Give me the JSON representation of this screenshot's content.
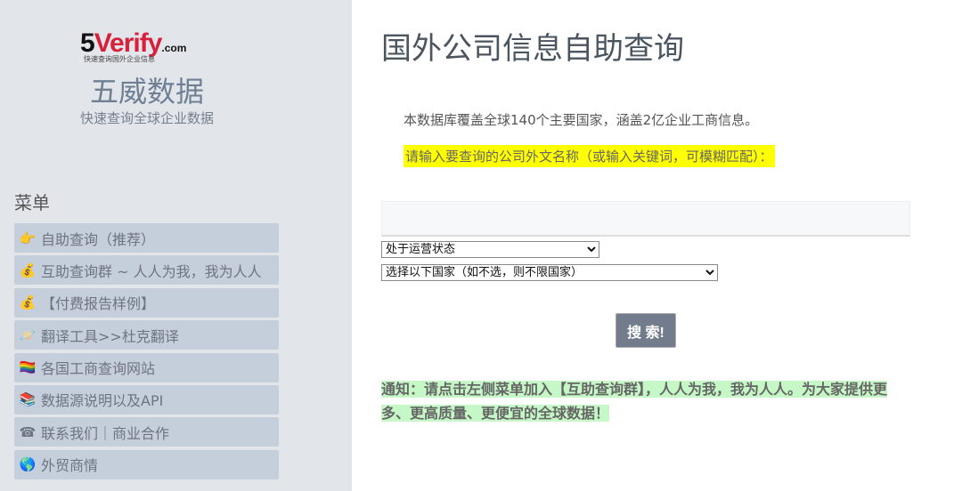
{
  "logo": {
    "five": "5",
    "verify": "Verify",
    "com": ".com",
    "tagline": "快速查询国外企业信息"
  },
  "brand": {
    "title": "五威数据",
    "subtitle": "快速查询全球企业数据"
  },
  "menu": {
    "title": "菜单",
    "items": [
      {
        "icon": "👉",
        "label": "自助查询（推荐）"
      },
      {
        "icon": "💰",
        "label": "互助查询群 ~ 人人为我，我为人人"
      },
      {
        "icon": "💰",
        "label": "【付费报告样例】"
      },
      {
        "icon": "🪐",
        "label": "翻译工具>>杜克翻译"
      },
      {
        "icon": "🏳️‍🌈",
        "label": "各国工商查询网站"
      },
      {
        "icon": "📚",
        "label": "数据源说明以及API"
      },
      {
        "icon": "☎",
        "label": "联系我们｜商业合作"
      },
      {
        "icon": "🌎",
        "label": "外贸商情"
      }
    ]
  },
  "main": {
    "title": "国外公司信息自助查询",
    "intro": "本数据库覆盖全球140个主要国家，涵盖2亿企业工商信息。",
    "prompt": "请输入要查询的公司外文名称（或输入关键词，可模糊匹配）：",
    "search_value": "",
    "status_select": "处于运营状态",
    "country_select": "选择以下国家（如不选，则不限国家）",
    "search_button": "搜 索!",
    "notice": "通知：请点击左侧菜单加入【互助查询群】，人人为我，我为人人。为大家提供更多、更高质量、更便宜的全球数据！"
  }
}
